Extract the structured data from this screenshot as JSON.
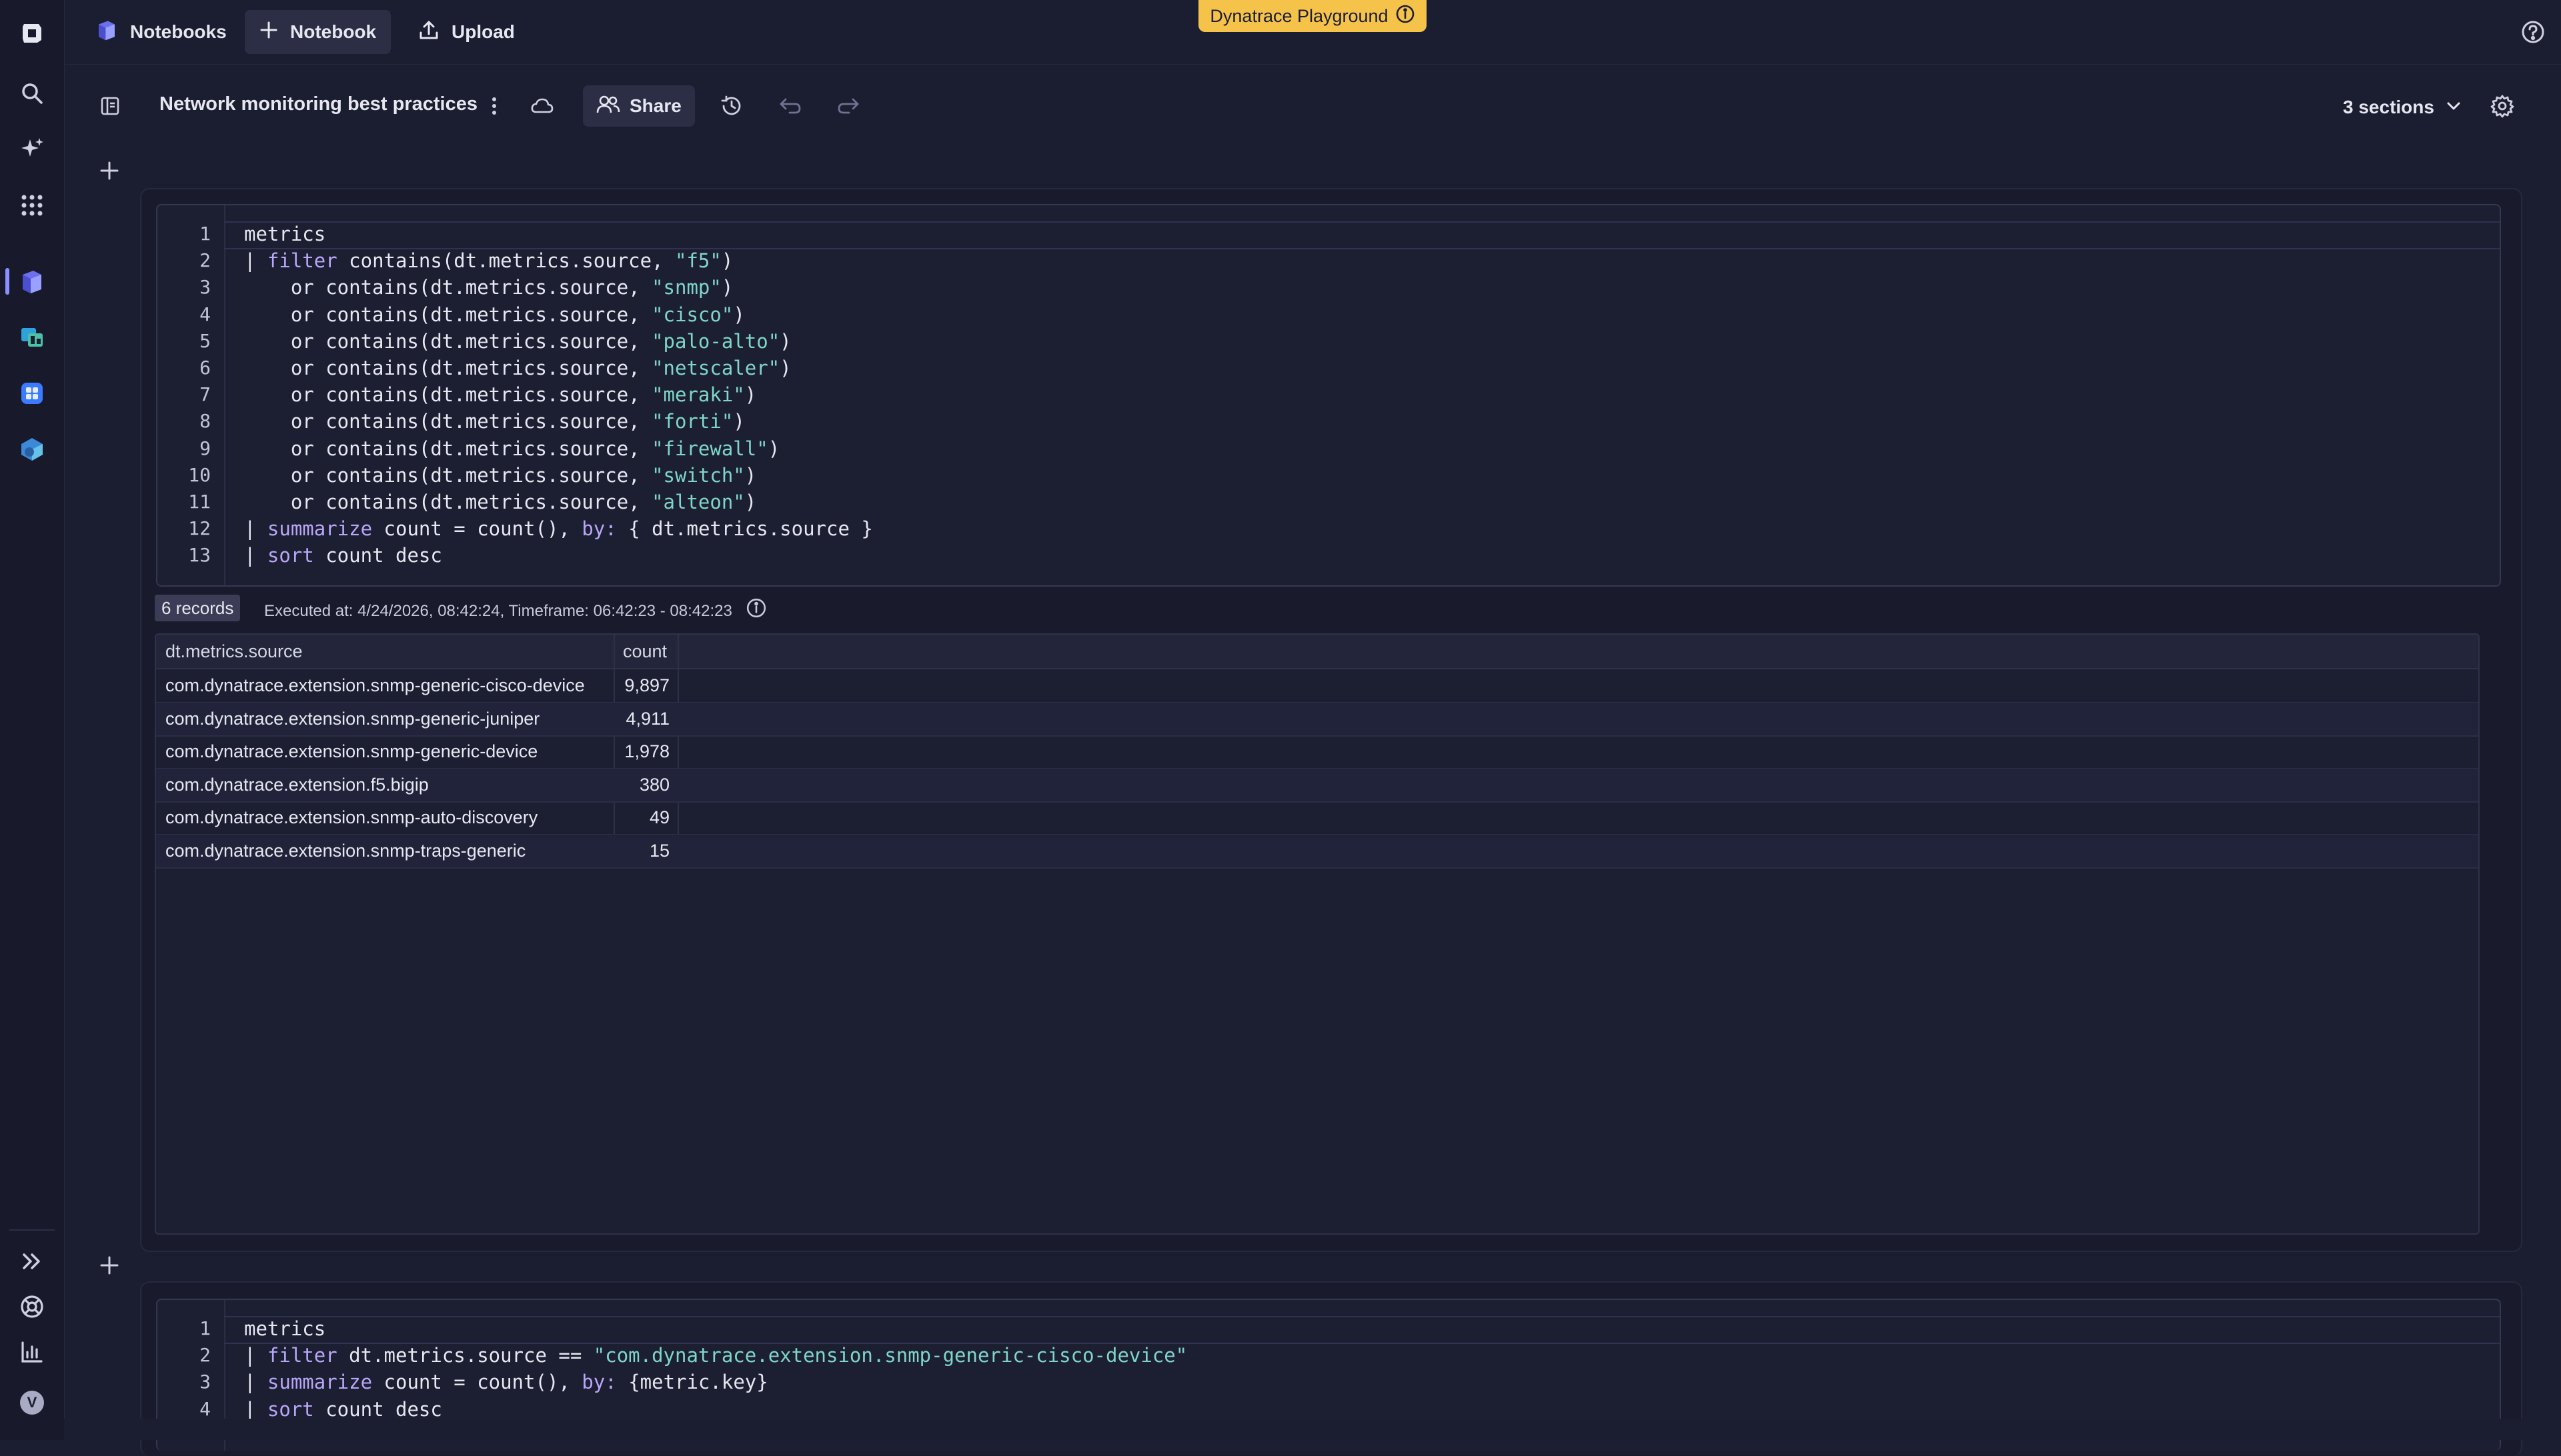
{
  "topbar": {
    "notebooks_label": "Notebooks",
    "new_notebook_label": "Notebook",
    "upload_label": "Upload",
    "playground_label": "Dynatrace Playground"
  },
  "header": {
    "title": "Network monitoring best practices",
    "share_label": "Share",
    "sections_label": "3 sections"
  },
  "sections": [
    {
      "line_numbers": [
        "1",
        "2",
        "3",
        "4",
        "5",
        "6",
        "7",
        "8",
        "9",
        "10",
        "11",
        "12",
        "13"
      ],
      "code": [
        [
          {
            "t": "metrics"
          }
        ],
        [
          {
            "t": "| "
          },
          {
            "t": "filter",
            "c": "kw"
          },
          {
            "t": " contains(dt.metrics.source, "
          },
          {
            "t": "\"f5\"",
            "c": "str"
          },
          {
            "t": ")"
          }
        ],
        [
          {
            "t": "    or contains(dt.metrics.source, "
          },
          {
            "t": "\"snmp\"",
            "c": "str"
          },
          {
            "t": ")"
          }
        ],
        [
          {
            "t": "    or contains(dt.metrics.source, "
          },
          {
            "t": "\"cisco\"",
            "c": "str"
          },
          {
            "t": ")"
          }
        ],
        [
          {
            "t": "    or contains(dt.metrics.source, "
          },
          {
            "t": "\"palo-alto\"",
            "c": "str"
          },
          {
            "t": ")"
          }
        ],
        [
          {
            "t": "    or contains(dt.metrics.source, "
          },
          {
            "t": "\"netscaler\"",
            "c": "str"
          },
          {
            "t": ")"
          }
        ],
        [
          {
            "t": "    or contains(dt.metrics.source, "
          },
          {
            "t": "\"meraki\"",
            "c": "str"
          },
          {
            "t": ")"
          }
        ],
        [
          {
            "t": "    or contains(dt.metrics.source, "
          },
          {
            "t": "\"forti\"",
            "c": "str"
          },
          {
            "t": ")"
          }
        ],
        [
          {
            "t": "    or contains(dt.metrics.source, "
          },
          {
            "t": "\"firewall\"",
            "c": "str"
          },
          {
            "t": ")"
          }
        ],
        [
          {
            "t": "    or contains(dt.metrics.source, "
          },
          {
            "t": "\"switch\"",
            "c": "str"
          },
          {
            "t": ")"
          }
        ],
        [
          {
            "t": "    or contains(dt.metrics.source, "
          },
          {
            "t": "\"alteon\"",
            "c": "str"
          },
          {
            "t": ")"
          }
        ],
        [
          {
            "t": "| "
          },
          {
            "t": "summarize",
            "c": "kw"
          },
          {
            "t": " count = count(), "
          },
          {
            "t": "by:",
            "c": "kw"
          },
          {
            "t": " { dt.metrics.source }"
          }
        ],
        [
          {
            "t": "| "
          },
          {
            "t": "sort",
            "c": "kw"
          },
          {
            "t": " count desc"
          }
        ]
      ],
      "records_label": "6 records",
      "executed_label": "Executed at: 4/24/2026, 08:42:24, Timeframe: 06:42:23 - 08:42:23",
      "table": {
        "columns": [
          "dt.metrics.source",
          "count"
        ],
        "rows": [
          [
            "com.dynatrace.extension.snmp-generic-cisco-device",
            "9,897"
          ],
          [
            "com.dynatrace.extension.snmp-generic-juniper",
            "4,911"
          ],
          [
            "com.dynatrace.extension.snmp-generic-device",
            "1,978"
          ],
          [
            "com.dynatrace.extension.f5.bigip",
            "380"
          ],
          [
            "com.dynatrace.extension.snmp-auto-discovery",
            "49"
          ],
          [
            "com.dynatrace.extension.snmp-traps-generic",
            "15"
          ]
        ]
      }
    },
    {
      "line_numbers": [
        "1",
        "2",
        "3",
        "4"
      ],
      "code": [
        [
          {
            "t": "metrics"
          }
        ],
        [
          {
            "t": "| "
          },
          {
            "t": "filter",
            "c": "kw"
          },
          {
            "t": " dt.metrics.source == "
          },
          {
            "t": "\"com.dynatrace.extension.snmp-generic-cisco-device\"",
            "c": "str"
          }
        ],
        [
          {
            "t": "| "
          },
          {
            "t": "summarize",
            "c": "kw"
          },
          {
            "t": " count = count(), "
          },
          {
            "t": "by:",
            "c": "kw"
          },
          {
            "t": " {metric.key}"
          }
        ],
        [
          {
            "t": "| "
          },
          {
            "t": "sort",
            "c": "kw"
          },
          {
            "t": " count desc"
          }
        ]
      ]
    }
  ],
  "rail": {
    "avatar_initial": "V"
  },
  "colors": {
    "accent": "#f5c24a",
    "keyword": "#b8a6f7",
    "string": "#7fd6c8",
    "background": "#1b1d30"
  }
}
